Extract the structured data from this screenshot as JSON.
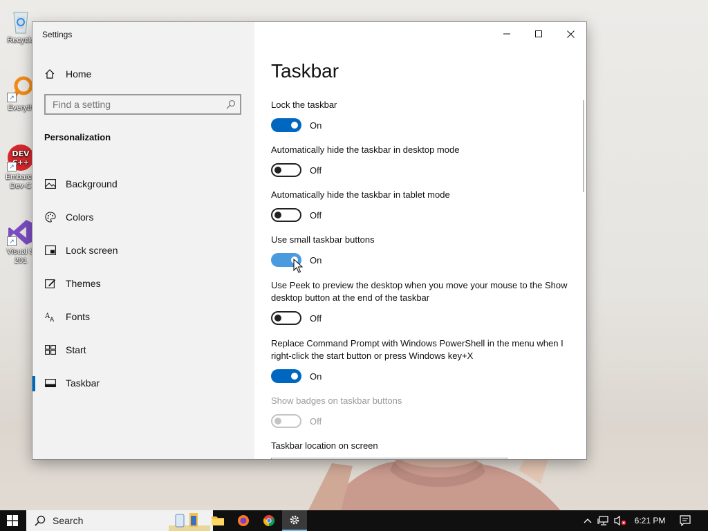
{
  "desktop": {
    "icons": [
      {
        "label": "Recycle"
      },
      {
        "label": "Everyth"
      },
      {
        "label": "Embarca Dev-C"
      },
      {
        "label": "Visual S 201"
      }
    ]
  },
  "window": {
    "title": "Settings",
    "controls": {
      "minimize": "minimize",
      "maximize": "maximize",
      "close": "close"
    }
  },
  "sidebar": {
    "home_label": "Home",
    "search_placeholder": "Find a setting",
    "section_title": "Personalization",
    "items": [
      {
        "label": "Background",
        "icon": "picture-icon",
        "selected": false
      },
      {
        "label": "Colors",
        "icon": "palette-icon",
        "selected": false
      },
      {
        "label": "Lock screen",
        "icon": "lock-screen-icon",
        "selected": false
      },
      {
        "label": "Themes",
        "icon": "themes-icon",
        "selected": false
      },
      {
        "label": "Fonts",
        "icon": "fonts-icon",
        "selected": false
      },
      {
        "label": "Start",
        "icon": "start-icon",
        "selected": false
      },
      {
        "label": "Taskbar",
        "icon": "taskbar-icon",
        "selected": true
      }
    ]
  },
  "content": {
    "title": "Taskbar",
    "settings": [
      {
        "label": "Lock the taskbar",
        "state": "On"
      },
      {
        "label": "Automatically hide the taskbar in desktop mode",
        "state": "Off"
      },
      {
        "label": "Automatically hide the taskbar in tablet mode",
        "state": "Off"
      },
      {
        "label": "Use small taskbar buttons",
        "state": "On"
      },
      {
        "label": "Use Peek to preview the desktop when you move your mouse to the Show desktop button at the end of the taskbar",
        "state": "Off"
      },
      {
        "label": "Replace Command Prompt with Windows PowerShell in the menu when I right-click the start button or press Windows key+X",
        "state": "On"
      },
      {
        "label": "Show badges on taskbar buttons",
        "state": "Off",
        "disabled": true
      }
    ],
    "location_label": "Taskbar location on screen"
  },
  "taskbar": {
    "search_text": "Search",
    "time": "6:21 PM",
    "accent": "#76b9ed"
  },
  "colors": {
    "accent": "#0067c0",
    "sidebar_bg": "#f2f2f2"
  }
}
